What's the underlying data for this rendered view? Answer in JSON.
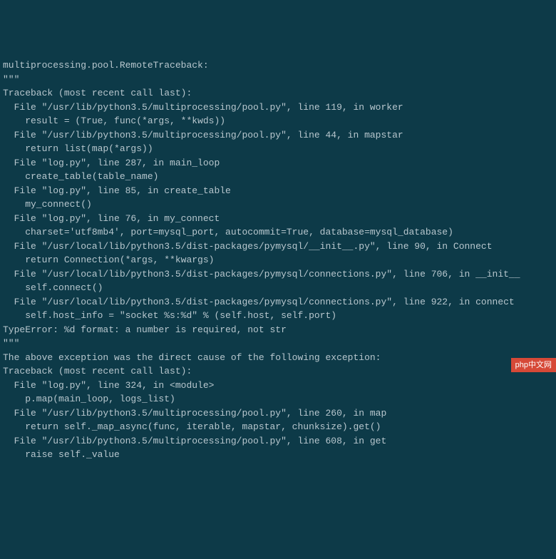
{
  "lines": [
    "multiprocessing.pool.RemoteTraceback:",
    "\"\"\"",
    "Traceback (most recent call last):",
    "  File \"/usr/lib/python3.5/multiprocessing/pool.py\", line 119, in worker",
    "    result = (True, func(*args, **kwds))",
    "  File \"/usr/lib/python3.5/multiprocessing/pool.py\", line 44, in mapstar",
    "    return list(map(*args))",
    "  File \"log.py\", line 287, in main_loop",
    "    create_table(table_name)",
    "  File \"log.py\", line 85, in create_table",
    "    my_connect()",
    "  File \"log.py\", line 76, in my_connect",
    "    charset='utf8mb4', port=mysql_port, autocommit=True, database=mysql_database)",
    "  File \"/usr/local/lib/python3.5/dist-packages/pymysql/__init__.py\", line 90, in Connect",
    "    return Connection(*args, **kwargs)",
    "  File \"/usr/local/lib/python3.5/dist-packages/pymysql/connections.py\", line 706, in __init__",
    "    self.connect()",
    "  File \"/usr/local/lib/python3.5/dist-packages/pymysql/connections.py\", line 922, in connect",
    "    self.host_info = \"socket %s:%d\" % (self.host, self.port)",
    "TypeError: %d format: a number is required, not str",
    "\"\"\"",
    "",
    "The above exception was the direct cause of the following exception:",
    "",
    "Traceback (most recent call last):",
    "  File \"log.py\", line 324, in <module>",
    "    p.map(main_loop, logs_list)",
    "  File \"/usr/lib/python3.5/multiprocessing/pool.py\", line 260, in map",
    "    return self._map_async(func, iterable, mapstar, chunksize).get()",
    "  File \"/usr/lib/python3.5/multiprocessing/pool.py\", line 608, in get",
    "    raise self._value"
  ],
  "badge": "php中文网"
}
